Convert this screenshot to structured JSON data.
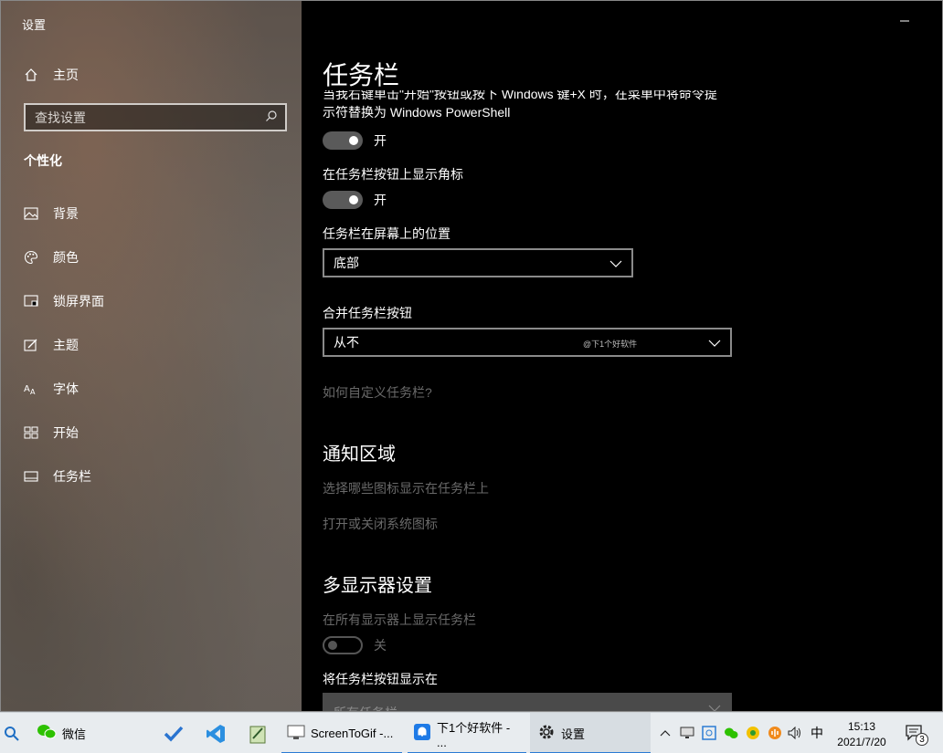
{
  "app": {
    "title": "设置"
  },
  "sidebar": {
    "home": "主页",
    "search_placeholder": "查找设置",
    "section": "个性化",
    "items": [
      {
        "label": "背景",
        "icon": "picture-icon"
      },
      {
        "label": "颜色",
        "icon": "palette-icon"
      },
      {
        "label": "锁屏界面",
        "icon": "lock-screen-icon"
      },
      {
        "label": "主题",
        "icon": "theme-icon"
      },
      {
        "label": "字体",
        "icon": "font-icon"
      },
      {
        "label": "开始",
        "icon": "start-icon"
      },
      {
        "label": "任务栏",
        "icon": "taskbar-icon"
      }
    ]
  },
  "main": {
    "title": "任务栏",
    "cut_text_line1": "当我右键单击\"开始\"按钮或按下 Windows 键+X 时，在菜单中将命令提",
    "cut_text_line2": "示符替换为 Windows PowerShell",
    "toggle1_state": "开",
    "badge_label": "在任务栏按钮上显示角标",
    "toggle2_state": "开",
    "position_label": "任务栏在屏幕上的位置",
    "position_value": "底部",
    "combine_label": "合并任务栏按钮",
    "combine_value": "从不",
    "watermark": "@下1个好软件",
    "customize_link": "如何自定义任务栏?",
    "notification_heading": "通知区域",
    "notif_link1": "选择哪些图标显示在任务栏上",
    "notif_link2": "打开或关闭系统图标",
    "multi_heading": "多显示器设置",
    "multi_label": "在所有显示器上显示任务栏",
    "multi_toggle_state": "关",
    "show_buttons_label": "将任务栏按钮显示在",
    "show_buttons_value": "所有任务栏"
  },
  "taskbar": {
    "wechat": "微信",
    "screentogif": "ScreenToGif -...",
    "notif_app": "下1个好软件 - ...",
    "settings": "设置",
    "ime": "中",
    "time": "15:13",
    "date": "2021/7/20",
    "notif_count": "3"
  }
}
